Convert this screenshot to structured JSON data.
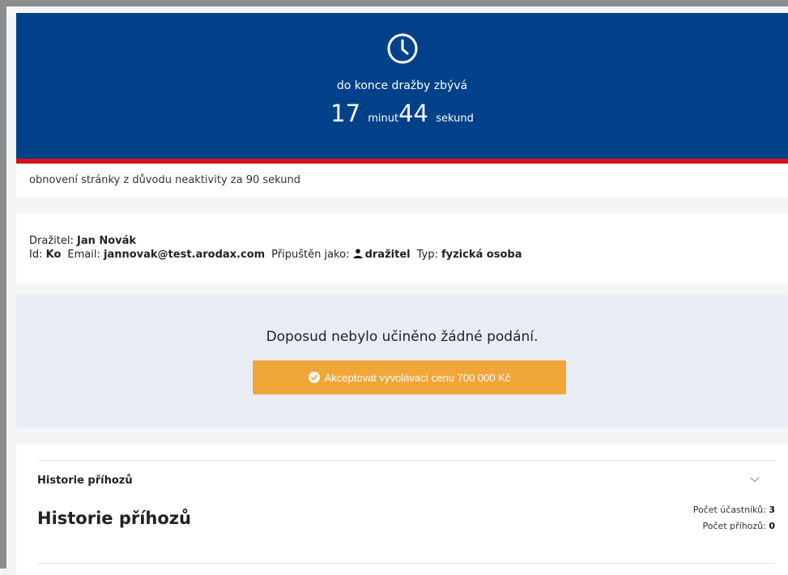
{
  "timer": {
    "label": "do konce dražby zbývá",
    "minutes": "17",
    "minutes_unit": "minut",
    "seconds": "44",
    "seconds_unit": "sekund",
    "icon": "clock-icon"
  },
  "refresh_notice": "obnovení stránky z důvodu neaktivity za 90 sekund",
  "bidder": {
    "label": "Dražitel:",
    "name": "Jan Novák",
    "id_label": "Id:",
    "id_value": "Ko",
    "email_label": "Email:",
    "email_value": "jannovak@test.arodax.com",
    "admitted_label": "Připuštěn jako:",
    "admitted_value": "dražitel",
    "admitted_icon": "user-icon",
    "type_label": "Typ:",
    "type_value": "fyzická osoba"
  },
  "submission": {
    "message": "Doposud nebylo učiněno žádné podání.",
    "accept_label": "Akceptovat vyvolávací cenu 700 000 Kč",
    "accept_icon": "check-circle-icon"
  },
  "history": {
    "accordion_title": "Historie příhozů",
    "title": "Historie příhozů",
    "participants_label": "Počet účastníků:",
    "participants_value": "3",
    "bids_label": "Počet příhozů:",
    "bids_value": "0",
    "toggle_icon": "chevron-down-icon"
  },
  "colors": {
    "timer_bg": "#00418a",
    "timer_bar": "#d5121b",
    "accept_button": "#f0a639",
    "submission_bg": "#e7ecf5"
  }
}
